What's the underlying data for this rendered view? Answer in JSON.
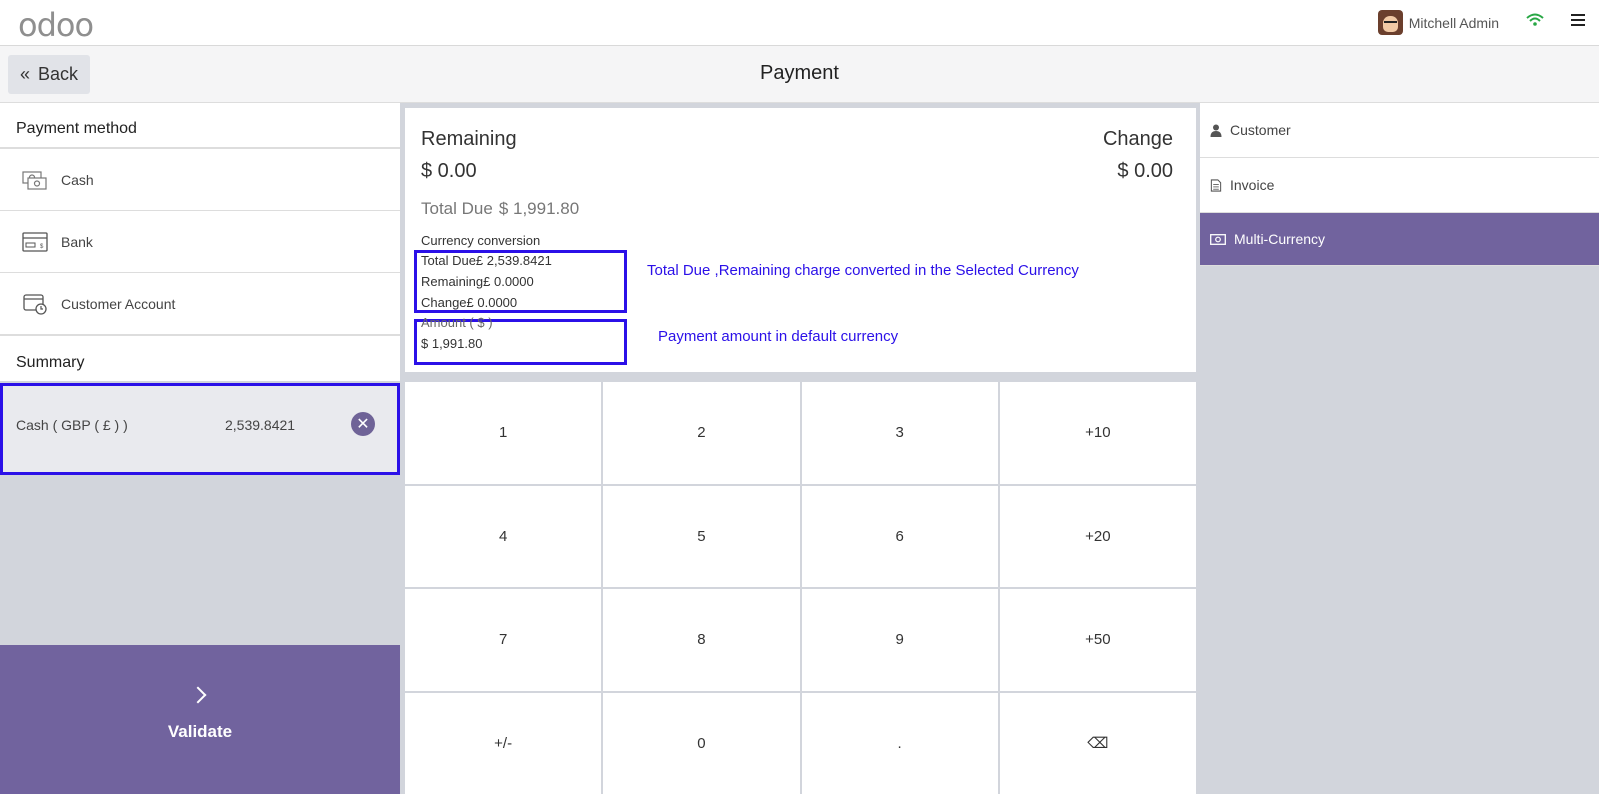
{
  "navbar": {
    "logo_text": "odoo",
    "user_name": "Mitchell Admin",
    "icons": [
      "avatar",
      "wifi-icon",
      "hamburger-menu-icon"
    ]
  },
  "header": {
    "back_label": "Back",
    "title": "Payment"
  },
  "payment_methods": {
    "title": "Payment method",
    "items": [
      {
        "label": "Cash",
        "icon": "cash-icon"
      },
      {
        "label": "Bank",
        "icon": "bank-card-icon"
      },
      {
        "label": "Customer Account",
        "icon": "customer-account-icon"
      }
    ]
  },
  "summary": {
    "title": "Summary",
    "lines": [
      {
        "name": "Cash ( GBP ( £ ) )",
        "amount": "2,539.8421",
        "delete_icon": "remove-icon"
      }
    ]
  },
  "validate": {
    "label": "Validate"
  },
  "status": {
    "remaining_label": "Remaining",
    "remaining_value": "$ 0.00",
    "change_label": "Change",
    "change_value": "$ 0.00",
    "total_due_label": "Total Due",
    "total_due_value": "$ 1,991.80",
    "conversion_title": "Currency conversion",
    "conv_total_due": "Total Due£ 2,539.8421",
    "conv_remaining": "Remaining£ 0.0000",
    "conv_change": "Change£ 0.0000",
    "amount_label": "Amount ( $ )",
    "amount_value": "$ 1,991.80"
  },
  "annotations": {
    "note1": "Total Due ,Remaining charge converted in the Selected Currency",
    "note2": "Payment amount in default currency",
    "box_color": "#2b10e8"
  },
  "numpad": {
    "keys": [
      "1",
      "2",
      "3",
      "+10",
      "4",
      "5",
      "6",
      "+20",
      "7",
      "8",
      "9",
      "+50",
      "+/-",
      "0",
      ".",
      "⌫"
    ]
  },
  "right_panel": {
    "items": [
      {
        "label": "Customer",
        "icon": "user-icon",
        "active": false
      },
      {
        "label": "Invoice",
        "icon": "document-icon",
        "active": false
      },
      {
        "label": "Multi-Currency",
        "icon": "money-icon",
        "active": true
      }
    ]
  },
  "colors": {
    "accent": "#71639e",
    "annotation": "#2b10e8"
  }
}
